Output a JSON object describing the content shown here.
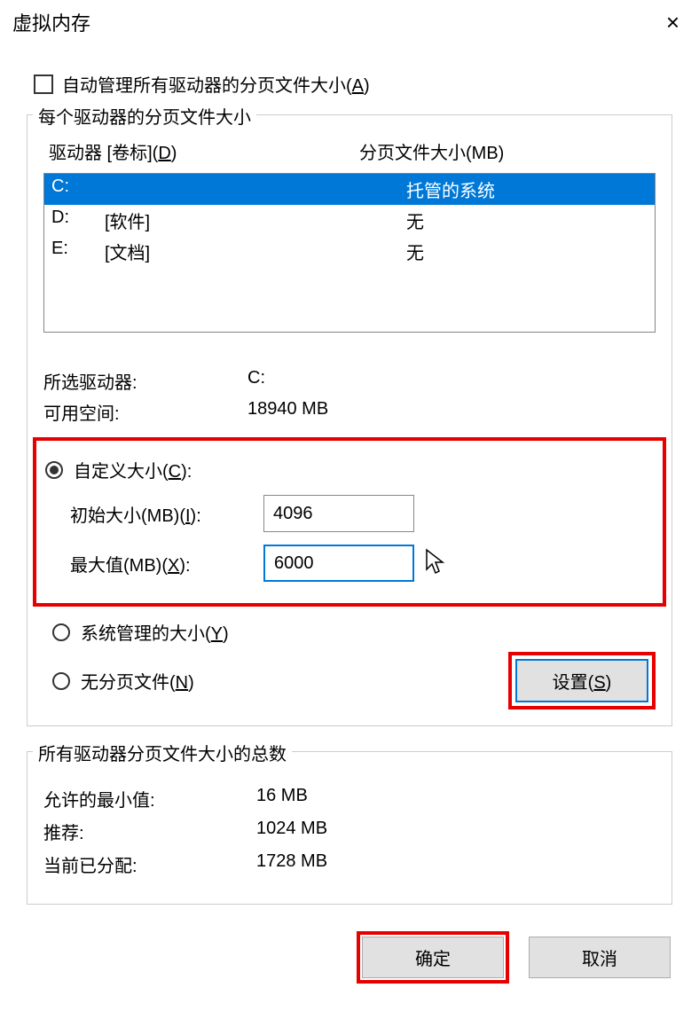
{
  "titlebar": {
    "title": "虚拟内存",
    "close_icon": "×"
  },
  "auto_manage": {
    "label_pre": "自动管理所有驱动器的分页文件大小(",
    "label_key": "A",
    "label_post": ")",
    "checked": false
  },
  "group_per_drive": {
    "label": "每个驱动器的分页文件大小",
    "header_drive_pre": "驱动器 [卷标](",
    "header_drive_key": "D",
    "header_drive_post": ")",
    "header_size": "分页文件大小(MB)",
    "drives": [
      {
        "letter": "C:",
        "label": "",
        "size": "托管的系统",
        "selected": true
      },
      {
        "letter": "D:",
        "label": "[软件]",
        "size": "无",
        "selected": false
      },
      {
        "letter": "E:",
        "label": "[文档]",
        "size": "无",
        "selected": false
      }
    ],
    "selected_drive_label": "所选驱动器:",
    "selected_drive_value": "C:",
    "free_space_label": "可用空间:",
    "free_space_value": "18940 MB",
    "custom_size_pre": "自定义大小(",
    "custom_size_key": "C",
    "custom_size_post": "):",
    "initial_label_pre": "初始大小(MB)(",
    "initial_label_key": "I",
    "initial_label_post": "):",
    "initial_value": "4096",
    "max_label_pre": "最大值(MB)(",
    "max_label_key": "X",
    "max_label_post": "):",
    "max_value": "6000",
    "system_managed_pre": "系统管理的大小(",
    "system_managed_key": "Y",
    "system_managed_post": ")",
    "no_paging_pre": "无分页文件(",
    "no_paging_key": "N",
    "no_paging_post": ")",
    "set_button_pre": "设置(",
    "set_button_key": "S",
    "set_button_post": ")"
  },
  "group_totals": {
    "label": "所有驱动器分页文件大小的总数",
    "min_allowed_label": "允许的最小值:",
    "min_allowed_value": "16 MB",
    "recommended_label": "推荐:",
    "recommended_value": "1024 MB",
    "allocated_label": "当前已分配:",
    "allocated_value": "1728 MB"
  },
  "buttons": {
    "ok": "确定",
    "cancel": "取消"
  }
}
